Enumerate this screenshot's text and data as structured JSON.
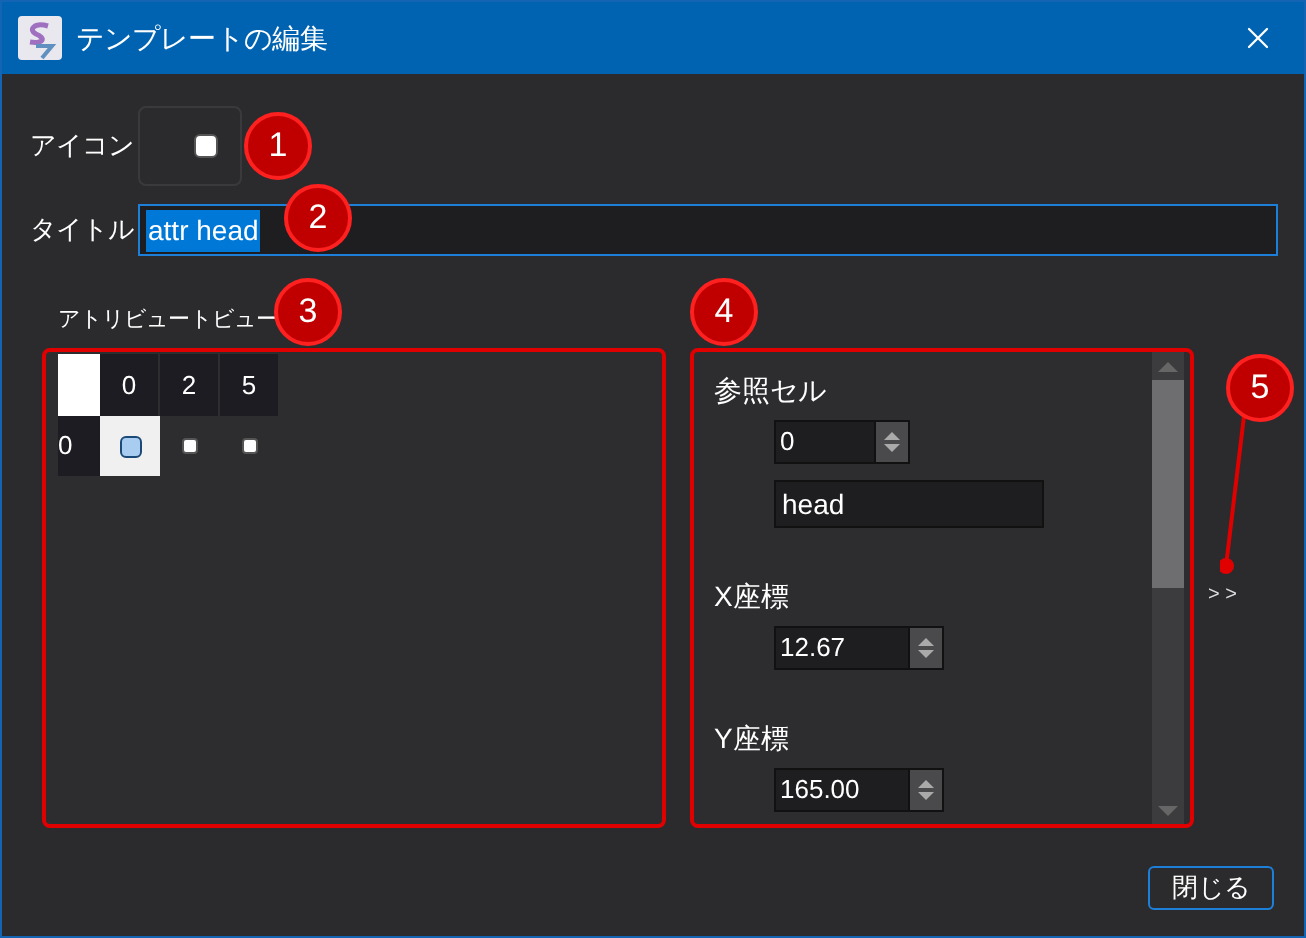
{
  "window": {
    "title": "テンプレートの編集"
  },
  "icon_field": {
    "label": "アイコン"
  },
  "title_field": {
    "label": "タイトル",
    "value": "attr head",
    "text_selected": true
  },
  "attribute_view": {
    "label": "アトリビュートビュー",
    "columns": [
      "0",
      "2",
      "5"
    ],
    "rows": [
      {
        "header": "0",
        "cells": [
          {
            "selected": true
          },
          {
            "selected": false
          },
          {
            "selected": false
          }
        ]
      }
    ]
  },
  "properties": [
    {
      "kind": "heading",
      "text": "参照セル"
    },
    {
      "kind": "spin",
      "value": "0"
    },
    {
      "kind": "text",
      "value": "head"
    },
    {
      "kind": "heading",
      "text": "X座標"
    },
    {
      "kind": "spin",
      "value": "12.67"
    },
    {
      "kind": "heading",
      "text": "Y座標"
    },
    {
      "kind": "spin",
      "value": "165.00"
    }
  ],
  "expand_button": "> >",
  "close_button": "閉じる",
  "callouts": [
    "1",
    "2",
    "3",
    "4",
    "5"
  ]
}
